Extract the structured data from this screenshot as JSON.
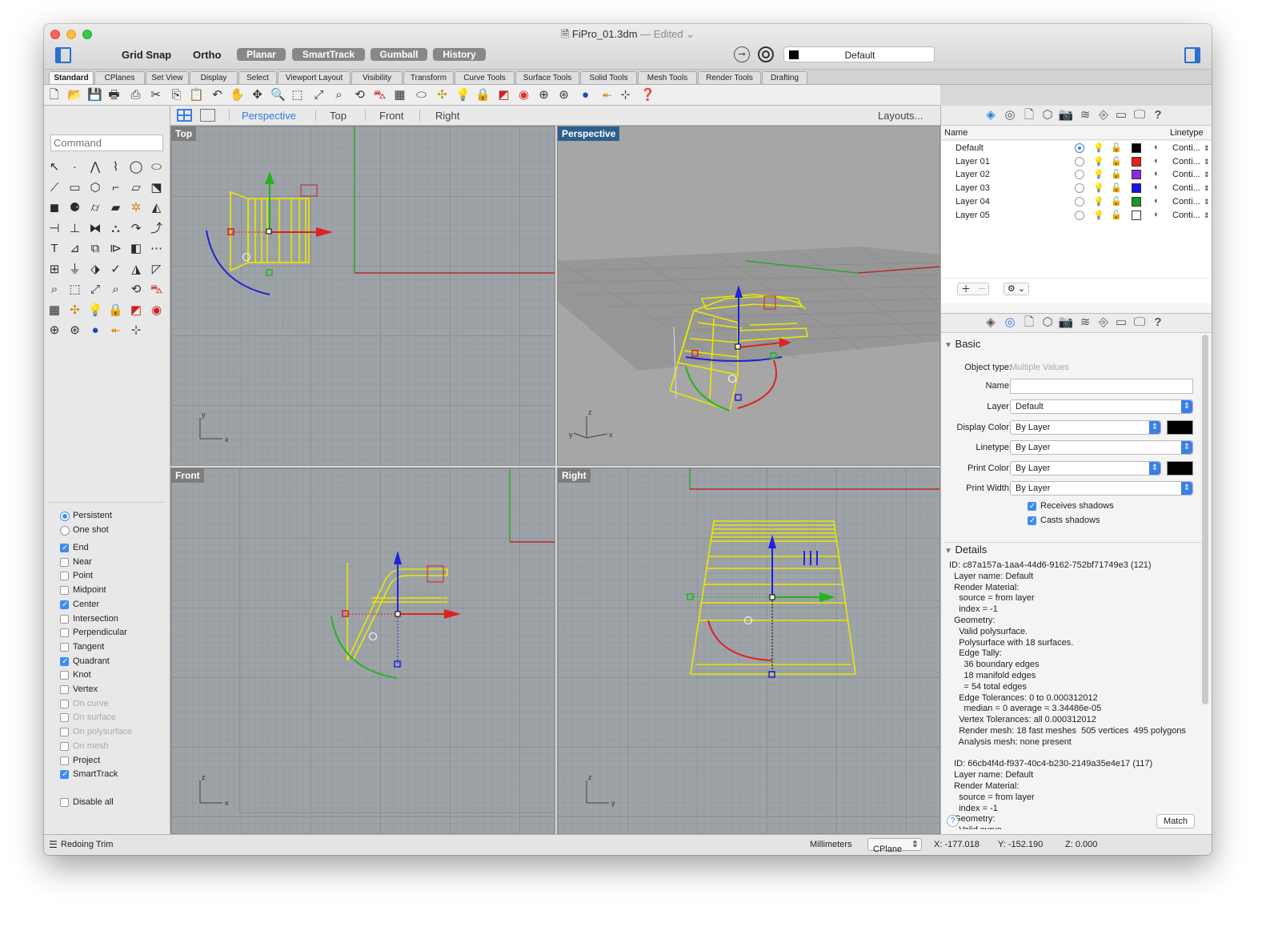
{
  "window": {
    "file_name": "FiPro_01.3dm",
    "edited": "— Edited"
  },
  "toolbar": {
    "grid_snap": "Grid Snap",
    "ortho": "Ortho",
    "planar": "Planar",
    "smarttrack": "SmartTrack",
    "gumball": "Gumball",
    "history": "History",
    "layer": "Default"
  },
  "tabs": [
    "Standard",
    "CPlanes",
    "Set View",
    "Display",
    "Select",
    "Viewport Layout",
    "Visibility",
    "Transform",
    "Curve Tools",
    "Surface Tools",
    "Solid Tools",
    "Mesh Tools",
    "Render Tools",
    "Drafting"
  ],
  "viewport_tabs": {
    "perspective": "Perspective",
    "top": "Top",
    "front": "Front",
    "right": "Right",
    "layouts": "Layouts..."
  },
  "command": {
    "placeholder": "Command"
  },
  "viewports": {
    "top": "Top",
    "perspective": "Perspective",
    "front": "Front",
    "right": "Right"
  },
  "osnap": {
    "persistent": "Persistent",
    "one_shot": "One shot",
    "items": [
      {
        "label": "End",
        "checked": true
      },
      {
        "label": "Near",
        "checked": false
      },
      {
        "label": "Point",
        "checked": false
      },
      {
        "label": "Midpoint",
        "checked": false
      },
      {
        "label": "Center",
        "checked": true
      },
      {
        "label": "Intersection",
        "checked": false
      },
      {
        "label": "Perpendicular",
        "checked": false
      },
      {
        "label": "Tangent",
        "checked": false
      },
      {
        "label": "Quadrant",
        "checked": true
      },
      {
        "label": "Knot",
        "checked": false
      },
      {
        "label": "Vertex",
        "checked": false
      },
      {
        "label": "On curve",
        "checked": false,
        "disabled": true
      },
      {
        "label": "On surface",
        "checked": false,
        "disabled": true
      },
      {
        "label": "On polysurface",
        "checked": false,
        "disabled": true
      },
      {
        "label": "On mesh",
        "checked": false,
        "disabled": true
      },
      {
        "label": "Project",
        "checked": false
      },
      {
        "label": "SmartTrack",
        "checked": true
      }
    ],
    "disable_all": "Disable all"
  },
  "layers": {
    "col_name": "Name",
    "col_linetype": "Linetype",
    "rows": [
      {
        "name": "Default",
        "color": "#000000",
        "linetype": "Conti...",
        "current": true
      },
      {
        "name": "Layer 01",
        "color": "#e8201a",
        "linetype": "Conti..."
      },
      {
        "name": "Layer 02",
        "color": "#8a2be2",
        "linetype": "Conti..."
      },
      {
        "name": "Layer 03",
        "color": "#1515e8",
        "linetype": "Conti..."
      },
      {
        "name": "Layer 04",
        "color": "#169c1a",
        "linetype": "Conti..."
      },
      {
        "name": "Layer 05",
        "color": "#ffffff",
        "linetype": "Conti..."
      }
    ]
  },
  "properties": {
    "basic": "Basic",
    "object_type_label": "Object type:",
    "object_type_value": "Multiple Values",
    "name_label": "Name:",
    "layer_label": "Layer:",
    "layer_value": "Default",
    "display_color_label": "Display Color:",
    "display_color_value": "By Layer",
    "linetype_label": "Linetype:",
    "linetype_value": "By Layer",
    "print_color_label": "Print Color:",
    "print_color_value": "By Layer",
    "print_width_label": "Print Width:",
    "print_width_value": "By Layer",
    "receives_shadows": "Receives shadows",
    "casts_shadows": "Casts shadows",
    "details": "Details",
    "detail_lines": [
      "ID: c87a157a-1aa4-44d6-9162-752bf71749e3 (121)",
      "  Layer name: Default",
      "  Render Material:",
      "    source = from layer",
      "    index = -1",
      "  Geometry:",
      "    Valid polysurface.",
      "    Polysurface with 18 surfaces.",
      "    Edge Tally:",
      "      36 boundary edges",
      "      18 manifold edges",
      "      = 54 total edges",
      "    Edge Tolerances: 0 to 0.000312012",
      "      median = 0 average = 3.34486e-05",
      "    Vertex Tolerances: all 0.000312012",
      "    Render mesh: 18 fast meshes  505 vertices  495 polygons",
      "    Analysis mesh: none present",
      "",
      "  ID: 66cb4f4d-f937-40c4-b230-2149a35e4e17 (117)",
      "  Layer name: Default",
      "  Render Material:",
      "    source = from layer",
      "    index = -1",
      "  Geometry:",
      "    Valid curve."
    ],
    "match": "Match",
    "help": "?"
  },
  "status": {
    "command": "Redoing Trim",
    "units": "Millimeters",
    "cplane": "CPlane",
    "x": "X: -177.018",
    "y": "Y: -152.190",
    "z": "Z: 0.000"
  }
}
